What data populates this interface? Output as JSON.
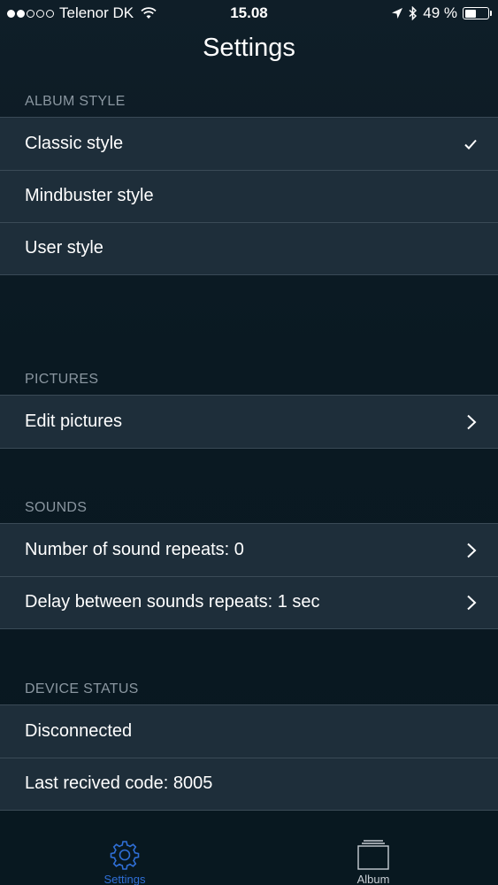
{
  "status_bar": {
    "carrier": "Telenor DK",
    "time": "15.08",
    "battery": "49 %",
    "battery_level": 0.49,
    "signal_dots": [
      true,
      true,
      false,
      false,
      false
    ]
  },
  "nav": {
    "title": "Settings"
  },
  "sections": {
    "album_style": {
      "header": "ALBUM STYLE",
      "rows": [
        "Classic style",
        "Mindbuster style",
        "User style"
      ],
      "selected": "Classic style"
    },
    "pictures": {
      "header": "PICTURES",
      "rows": [
        "Edit pictures"
      ]
    },
    "sounds": {
      "header": "SOUNDS",
      "rows": [
        "Number of sound repeats: 0",
        "Delay between sounds repeats: 1 sec"
      ]
    },
    "device_status": {
      "header": "DEVICE STATUS",
      "rows": [
        "Disconnected",
        "Last recived code: 8005"
      ]
    }
  },
  "tab_bar": {
    "tabs": [
      {
        "label": "Settings",
        "icon": "gear-icon",
        "active": true
      },
      {
        "label": "Album",
        "icon": "album-stack-icon",
        "active": false
      }
    ]
  },
  "colors": {
    "accent": "#2f6fd6",
    "row_background": "#1e2e3a",
    "separator": "#3a4a56",
    "section_header": "#8a96a0"
  }
}
